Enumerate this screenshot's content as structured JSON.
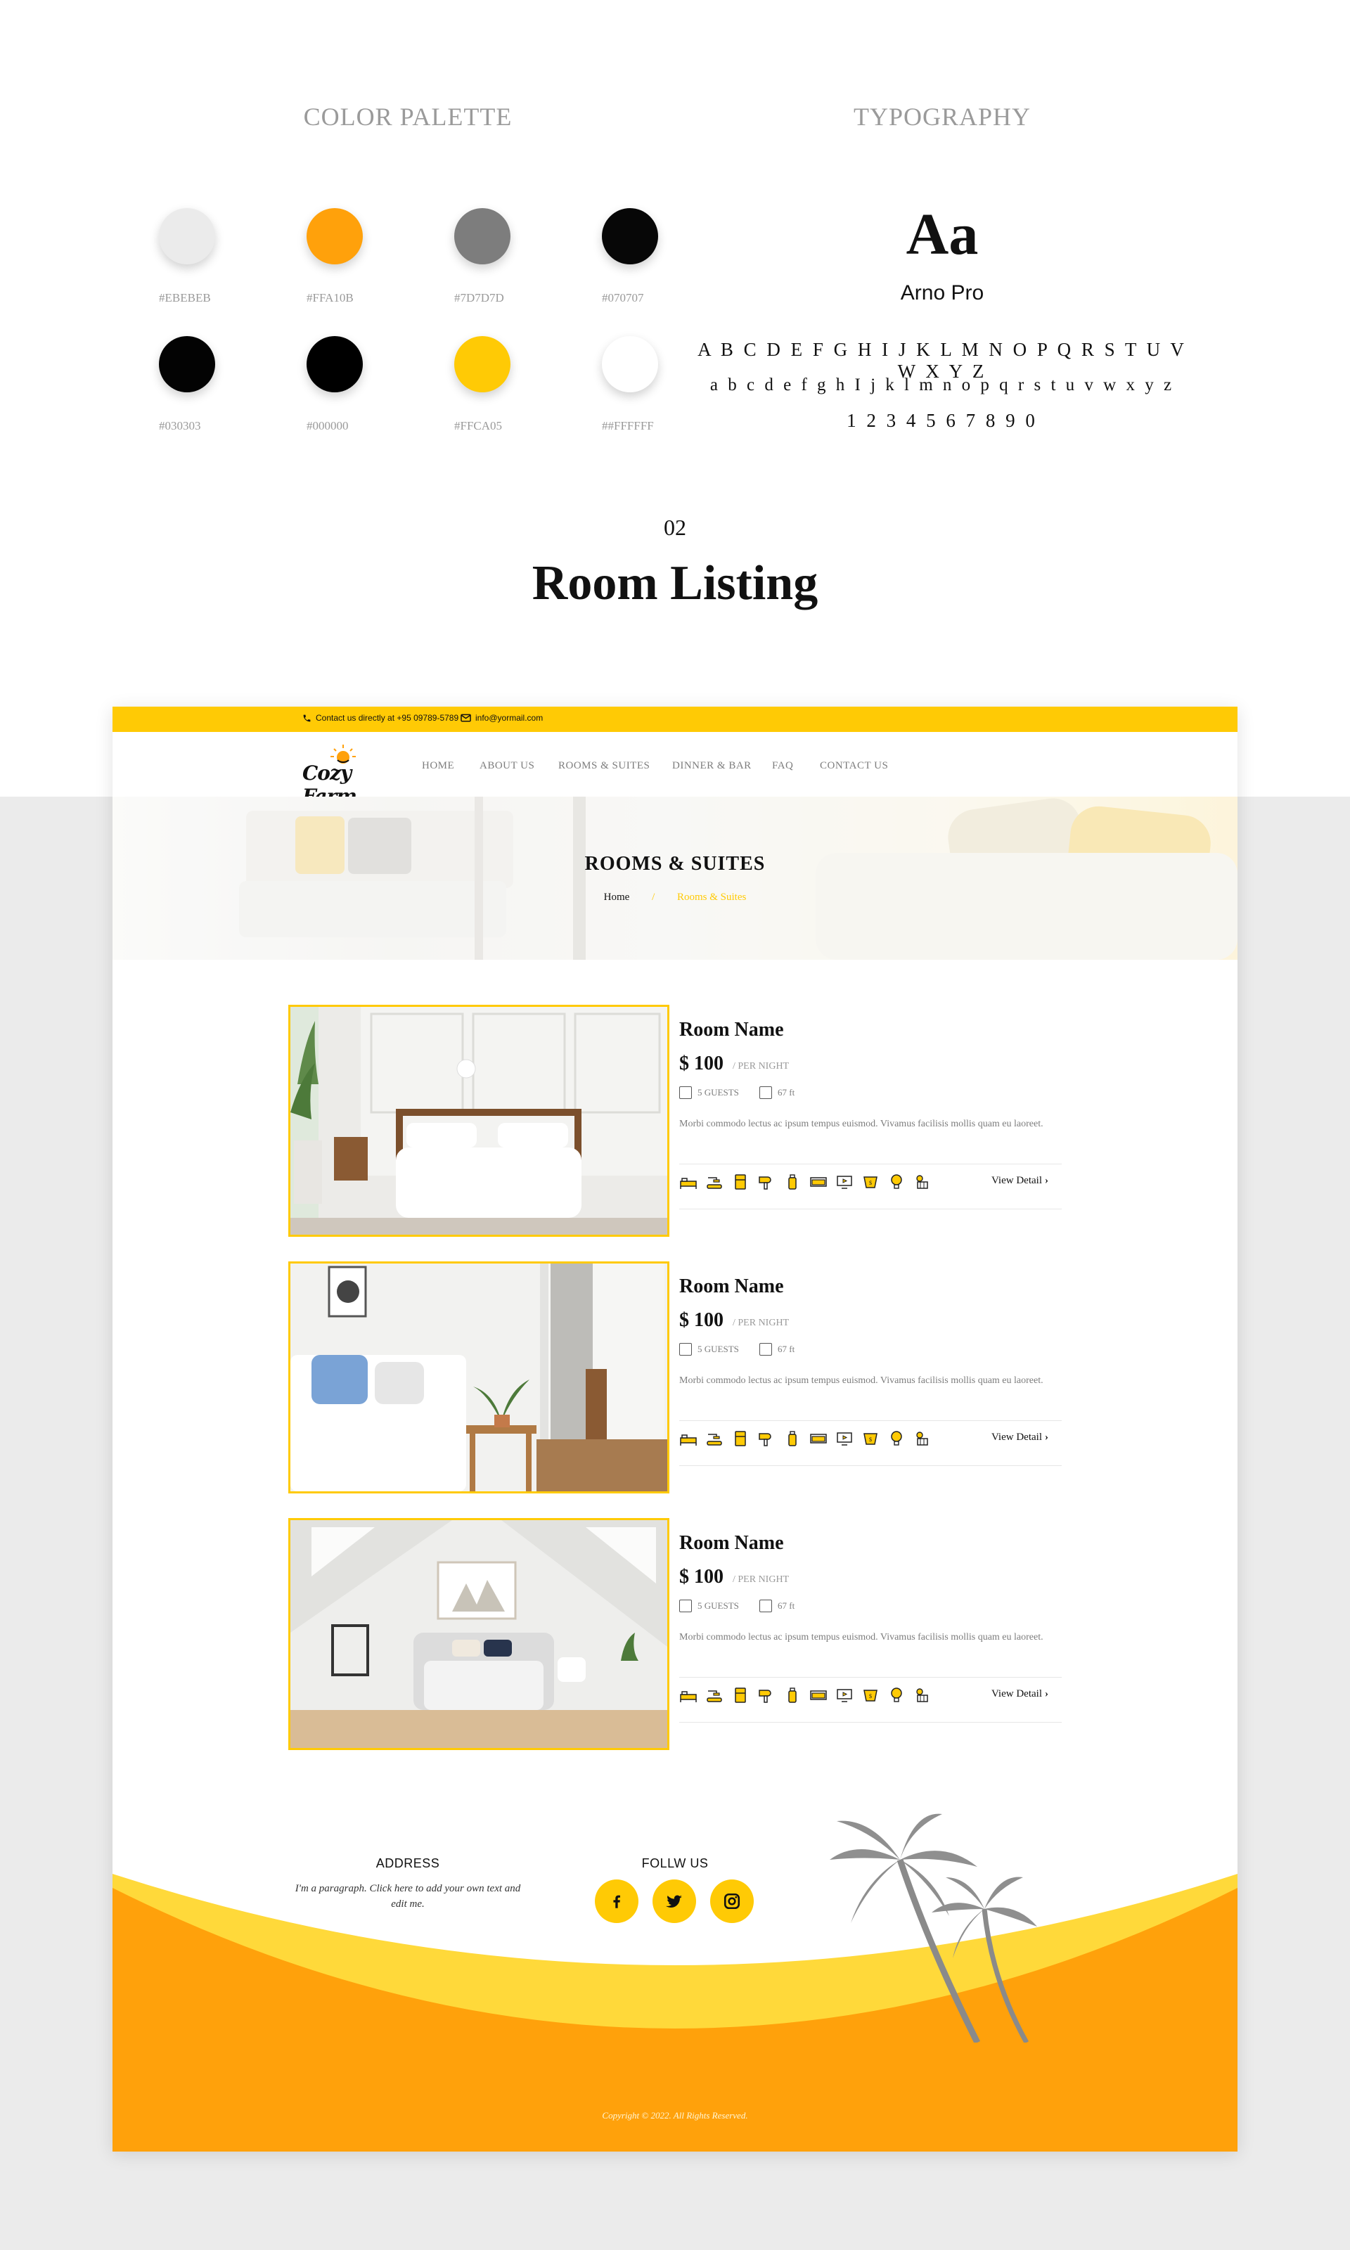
{
  "style_guide": {
    "color_palette_title": "COLOR PALETTE",
    "typography_title": "TYPOGRAPHY",
    "swatches": [
      {
        "hex": "#EBEBEB",
        "label": "#EBEBEB"
      },
      {
        "hex": "#FFA10B",
        "label": "#FFA10B"
      },
      {
        "hex": "#7D7D7D",
        "label": "#7D7D7D"
      },
      {
        "hex": "#070707",
        "label": "#070707"
      },
      {
        "hex": "#030303",
        "label": "#030303"
      },
      {
        "hex": "#000000",
        "label": "#000000"
      },
      {
        "hex": "#FFCA05",
        "label": "#FFCA05"
      },
      {
        "hex": "#FFFFFF",
        "label": "##FFFFFF"
      }
    ],
    "typography": {
      "sample": "Aa",
      "font_name": "Arno Pro",
      "uppercase": "A B C D E F G H I J K L M N O P Q R S T U V W X Y Z",
      "lowercase": "a b c d e f g h I j k l m n o p q r s t u v w x y z",
      "digits": "1 2 3 4 5 6 7 8 9 0"
    },
    "section_number": "02",
    "section_heading": "Room Listing"
  },
  "site": {
    "topbar": {
      "phone_text": "Contact us directly at +95 09789-5789",
      "email_text": "info@yormail.com"
    },
    "logo_text": "Cozy Farm",
    "nav": [
      "HOME",
      "ABOUT US",
      "ROOMS & SUITES",
      "DINNER & BAR",
      "FAQ",
      "CONTACT US"
    ],
    "hero": {
      "title": "ROOMS & SUITES",
      "breadcrumb_home": "Home",
      "breadcrumb_sep": "/",
      "breadcrumb_current": "Rooms & Suites"
    },
    "rooms": [
      {
        "name": "Room Name",
        "price": "$ 100",
        "per": "/ PER NIGHT",
        "guests": "5 GUESTS",
        "size": "67 ft",
        "description": "Morbi commodo lectus ac ipsum tempus euismod. Vivamus facilisis mollis quam eu laoreet.",
        "view_detail": "View Detail"
      },
      {
        "name": "Room Name",
        "price": "$ 100",
        "per": "/ PER NIGHT",
        "guests": "5 GUESTS",
        "size": "67 ft",
        "description": "Morbi commodo lectus ac ipsum tempus euismod. Vivamus facilisis mollis quam eu laoreet.",
        "view_detail": "View Detail"
      },
      {
        "name": "Room Name",
        "price": "$ 100",
        "per": "/ PER NIGHT",
        "guests": "5 GUESTS",
        "size": "67 ft",
        "description": "Morbi commodo lectus ac ipsum tempus euismod. Vivamus facilisis mollis quam eu laoreet.",
        "view_detail": "View Detail"
      }
    ],
    "amenity_icons": [
      "bed-icon",
      "shower-icon",
      "fridge-icon",
      "hairdryer-icon",
      "bottle-icon",
      "sofa-icon",
      "tv-icon",
      "safe-icon",
      "lamp-icon",
      "cleaning-icon"
    ],
    "footer": {
      "address_title": "ADDRESS",
      "address_text": "I'm a paragraph. Click here to add your own text and edit me.",
      "follow_title": "FOLLW US",
      "socials": [
        "facebook-icon",
        "twitter-icon",
        "instagram-icon"
      ],
      "copyright": "Copyright © 2022. All Rights Reserved."
    },
    "colors": {
      "accent": "#FFCA05",
      "orange": "#FFA10B",
      "grey": "#7D7D7D",
      "light": "#EBEBEB"
    }
  }
}
